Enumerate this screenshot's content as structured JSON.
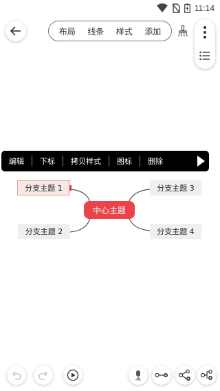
{
  "status_bar": {
    "time": "11:14",
    "icons": [
      "wifi-icon",
      "no-sim-icon",
      "battery-charging-icon"
    ]
  },
  "toolbar": {
    "back_icon": "arrow-left-icon",
    "tabs": [
      {
        "label": "布局"
      },
      {
        "label": "线条"
      },
      {
        "label": "样式"
      },
      {
        "label": "添加"
      }
    ],
    "clear_icon": "brush-icon",
    "more_icon": "more-vertical-icon",
    "outline_icon": "list-icon"
  },
  "context_menu": {
    "items": [
      {
        "label": "编辑"
      },
      {
        "label": "下标"
      },
      {
        "label": "拷贝样式"
      },
      {
        "label": "图标"
      },
      {
        "label": "删除"
      }
    ],
    "more_icon": "play-right-icon"
  },
  "mindmap": {
    "center": {
      "label": "中心主题",
      "color": "#e8444a"
    },
    "branches": [
      {
        "label": "分支主题 1",
        "selected": true
      },
      {
        "label": "分支主题 2",
        "selected": false
      },
      {
        "label": "分支主题 3",
        "selected": false
      },
      {
        "label": "分支主题 4",
        "selected": false
      }
    ]
  },
  "bottom_bar": {
    "buttons": [
      {
        "icon": "undo-icon",
        "enabled": false
      },
      {
        "icon": "redo-icon",
        "enabled": false
      },
      {
        "icon": "play-circle-icon",
        "enabled": true
      },
      {
        "icon": "microphone-icon",
        "enabled": true
      },
      {
        "icon": "add-sibling-icon",
        "enabled": true
      },
      {
        "icon": "add-child-icon",
        "enabled": true
      },
      {
        "icon": "add-parent-icon",
        "enabled": true
      }
    ]
  }
}
